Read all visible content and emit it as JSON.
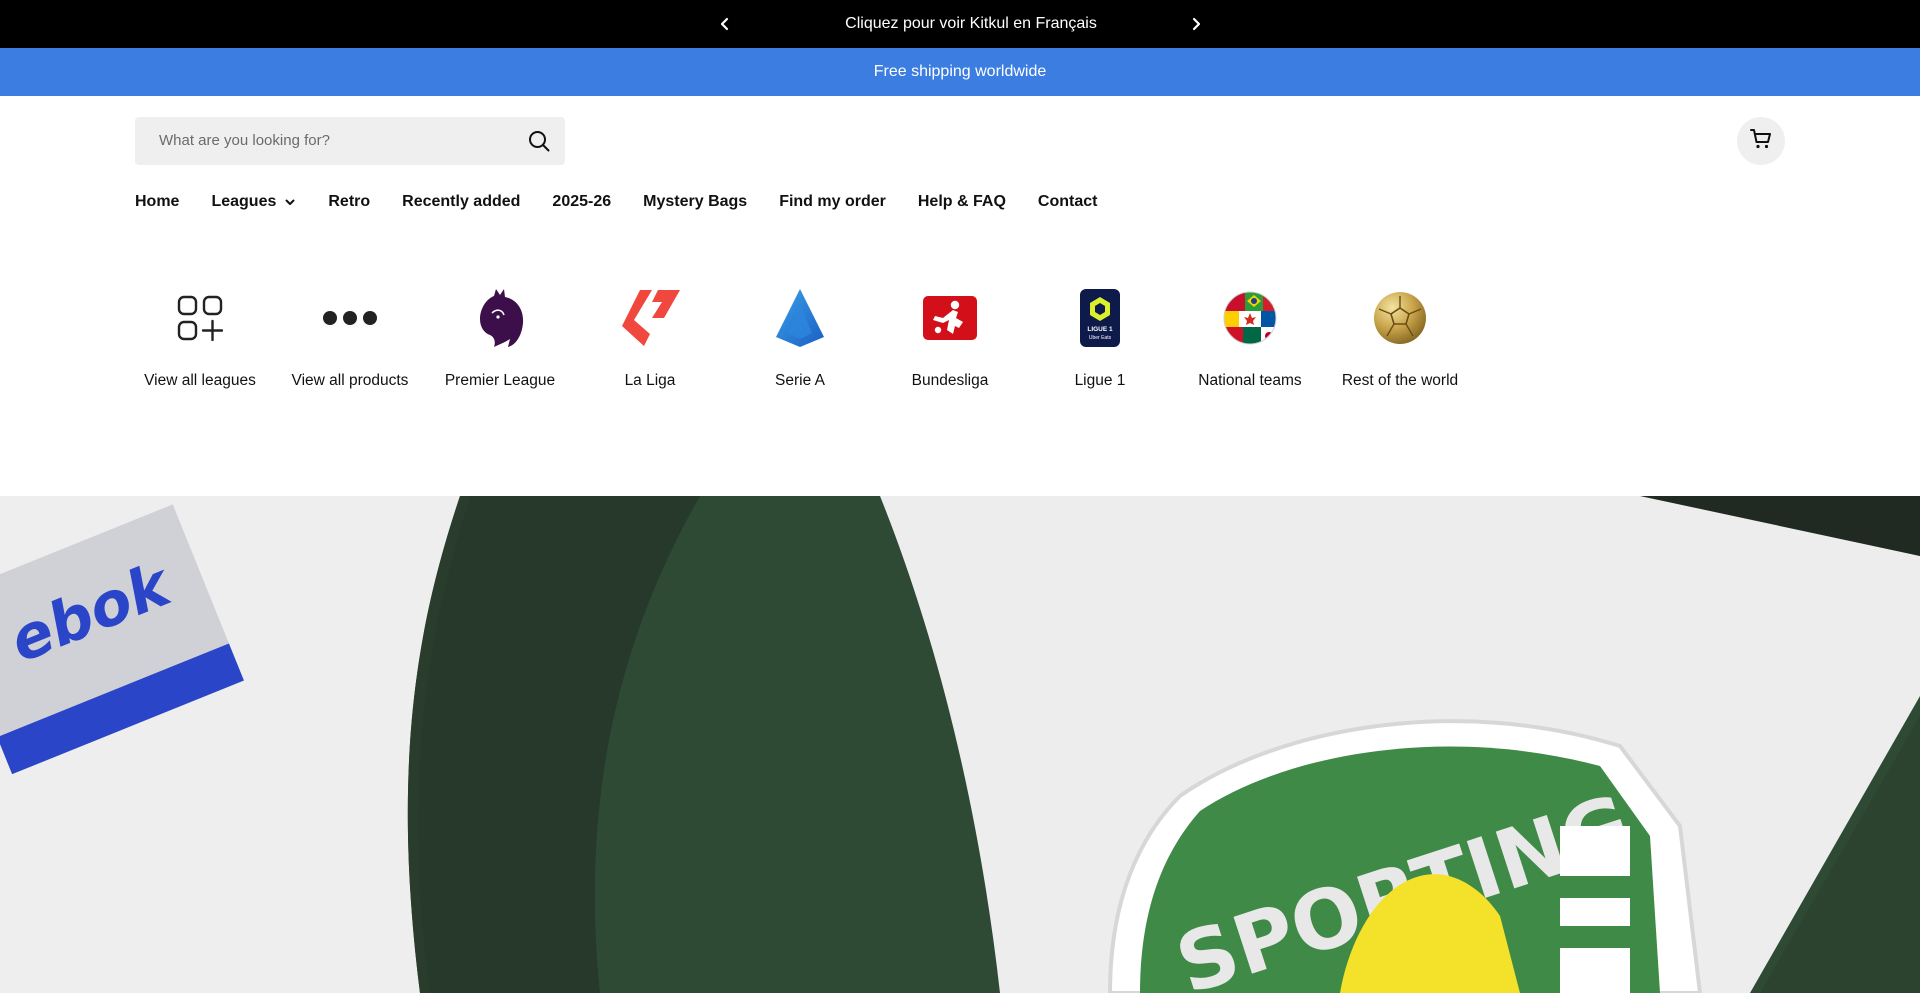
{
  "announcement": {
    "text": "Cliquez pour voir Kitkul en Français",
    "prev_icon": "chevron-left-icon",
    "next_icon": "chevron-right-icon"
  },
  "shipping_bar": {
    "text": "Free shipping worldwide",
    "background": "#3b7de0"
  },
  "search": {
    "placeholder": "What are you looking for?",
    "icon": "search-icon"
  },
  "cart": {
    "icon": "cart-icon"
  },
  "nav": {
    "items": [
      "Home",
      "Leagues",
      "Retro",
      "Recently added",
      "2025-26",
      "Mystery Bags",
      "Find my order",
      "Help & FAQ",
      "Contact"
    ]
  },
  "leagues": [
    {
      "label": "View all leagues",
      "icon": "grid-plus-icon"
    },
    {
      "label": "View all products",
      "icon": "dots-icon"
    },
    {
      "label": "Premier League",
      "icon": "premier-league-lion-icon"
    },
    {
      "label": "La Liga",
      "icon": "la-liga-logo-icon"
    },
    {
      "label": "Serie A",
      "icon": "serie-a-logo-icon"
    },
    {
      "label": "Bundesliga",
      "icon": "bundesliga-logo-icon"
    },
    {
      "label": "Ligue 1",
      "icon": "ligue-1-logo-icon"
    },
    {
      "label": "National teams",
      "icon": "flags-ball-icon"
    },
    {
      "label": "Rest of the world",
      "icon": "gold-ball-icon"
    }
  ],
  "ligue1_logo_text": [
    "LIGUE 1",
    "Uber Eats"
  ],
  "hero": {
    "crest_text": "SPORTING",
    "tag_text": "ebok",
    "colors": {
      "green": "#3f8a46",
      "dark_green": "#2f4a34",
      "white": "#f2f2f2",
      "yellow": "#f3e12a",
      "blue": "#2a45c8"
    }
  }
}
